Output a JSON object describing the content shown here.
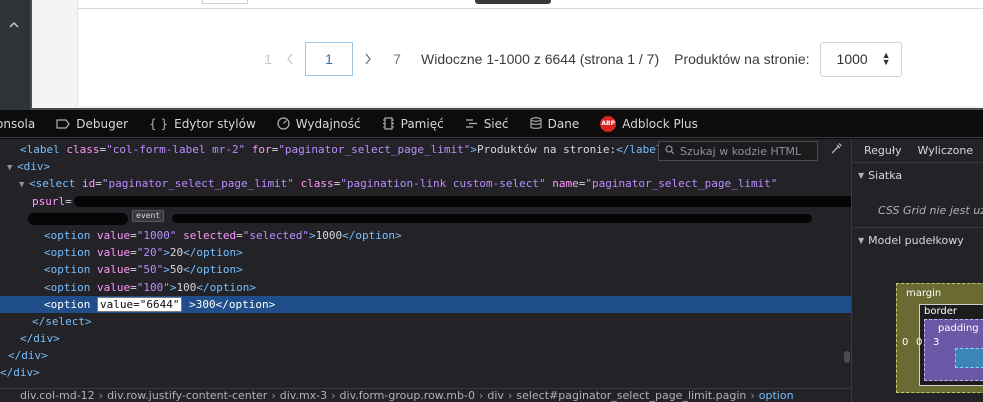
{
  "page": {
    "pagination": {
      "prev_page": "1",
      "current_page": "1",
      "last_page": "7",
      "info": "Widoczne 1-1000 z 6644 (strona 1 / 7)",
      "per_page_label": "Produktów na stronie:",
      "per_page_value": "1000"
    }
  },
  "devtools": {
    "tabs": [
      {
        "label": "onsola",
        "icon": "console-icon"
      },
      {
        "label": "Debuger",
        "icon": "debugger-icon"
      },
      {
        "label": "Edytor stylów",
        "icon": "style-editor-icon"
      },
      {
        "label": "Wydajność",
        "icon": "performance-icon"
      },
      {
        "label": "Pamięć",
        "icon": "memory-icon"
      },
      {
        "label": "Sieć",
        "icon": "network-icon"
      },
      {
        "label": "Dane",
        "icon": "storage-icon"
      },
      {
        "label": "Adblock Plus",
        "icon": "adblock-plus-icon"
      }
    ],
    "abp_badge": "ABP",
    "search_placeholder": "Szukaj w kodzie HTML",
    "tree": {
      "l0": {
        "attr1": "class",
        "val1": "\"col-form-label mr-2\"",
        "attr2": "for",
        "val2": "\"paginator_select_page_limit\"",
        "text": "Produktów na stronie:"
      },
      "l1": {
        "tag": "div"
      },
      "l2": {
        "tag": "select",
        "attr1": "id",
        "val1": "\"paginator_select_page_limit\"",
        "attr2": "class",
        "val2": "\"pagination-link custom-select\"",
        "attr3": "name",
        "val3": "\"paginator_select_page_limit\""
      },
      "l3": {
        "attr": "psurl",
        "badge": "event"
      },
      "options": [
        {
          "value": "\"1000\"",
          "extra_attr": "selected",
          "extra_val": "\"selected\"",
          "text": "1000"
        },
        {
          "value": "\"20\"",
          "text": "20"
        },
        {
          "value": "\"50\"",
          "text": "50"
        },
        {
          "value": "\"100\"",
          "text": "100"
        }
      ],
      "edited_option": {
        "edit": "value=\"6644\"",
        "text": "300"
      },
      "closing": {
        "select": "/select",
        "div": "/div"
      }
    },
    "breadcrumbs": [
      "div.col-md-12",
      "div.row.justify-content-center",
      "div.mx-3",
      "div.form-group.row.mb-0",
      "div",
      "select#paginator_select_page_limit.pagin",
      "option"
    ],
    "side": {
      "tabs": [
        "Reguły",
        "Wyliczone"
      ],
      "grid_header": "Siatka",
      "grid_note": "CSS Grid nie jest użyty",
      "boxmodel_header": "Model pudełkowy",
      "margin_label": "margin",
      "border_label": "border",
      "padding_label": "padding",
      "nums": {
        "margin_left": "0",
        "border_left": "0",
        "padding_left": "3"
      }
    }
  }
}
